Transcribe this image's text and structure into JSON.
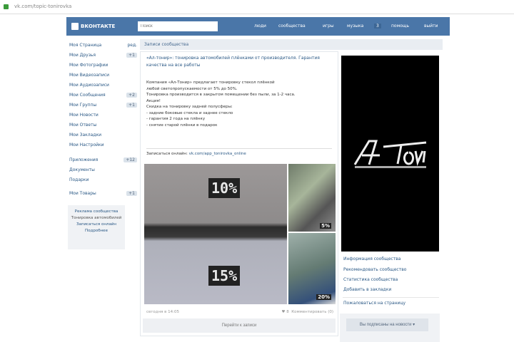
{
  "browser": {
    "url": "vk.com/topic-tonirovka"
  },
  "header": {
    "logo": "ВКОНТАКТЕ",
    "search_placeholder": "Поиск",
    "nav": [
      "люди",
      "сообщества",
      "игры",
      "музыка",
      "помощь",
      "выйти"
    ],
    "badge": "3"
  },
  "sidebar": {
    "items": [
      {
        "label": "Моя Страница",
        "count": "ред."
      },
      {
        "label": "Мои Друзья",
        "count": "+1"
      },
      {
        "label": "Мои Фотографии",
        "count": ""
      },
      {
        "label": "Мои Видеозаписи",
        "count": ""
      },
      {
        "label": "Мои Аудиозаписи",
        "count": ""
      },
      {
        "label": "Мои Сообщения",
        "count": "+2"
      },
      {
        "label": "Мои Группы",
        "count": "+1"
      },
      {
        "label": "Мои Новости",
        "count": ""
      },
      {
        "label": "Мои Ответы",
        "count": ""
      },
      {
        "label": "Мои Закладки",
        "count": ""
      },
      {
        "label": "Мои Настройки",
        "count": ""
      },
      {
        "label": "Приложения",
        "count": "+12"
      },
      {
        "label": "Документы",
        "count": ""
      },
      {
        "label": "Подарки",
        "count": ""
      },
      {
        "label": "Мои Товары",
        "count": "+1"
      }
    ],
    "promo": [
      "Реклама сообщества",
      "Тонировка автомобилей",
      "Записаться онлайн",
      "Подробнее"
    ]
  },
  "wall": {
    "header": "Записи сообщества",
    "post_title": "«Ал-тонир»: тонировка автомобилей плёнками от производителя. Гарантия качества на все работы",
    "post_lines": [
      "Компания «Ал-Тонир» предлагает тонировку стекол плёнкой",
      "любой светопропускаемости от 5% до 50%.",
      "Тонировка производится в закрытом помещении без пыли, за 1-2 часа.",
      "Акция!",
      "Скидка на тонировку задней полусферы:",
      "- задние боковые стекла и заднее стекло",
      "- гарантия 2 года на плёнку",
      "- снятие старой плёнки в подарок"
    ],
    "link_label": "Записаться онлайн:",
    "link": "vk.com/app_tonirovka_online",
    "photo_labels": [
      "10%",
      "15%",
      "5%",
      "20%"
    ],
    "date": "сегодня в 14:05",
    "likes": "8",
    "comments": "Комментировать (0)",
    "goto": "Перейти к записи"
  },
  "right": {
    "logo_text": "Al-Tonir",
    "links": [
      "Информация сообщества",
      "Рекомендовать сообщество",
      "Статистика сообщества",
      "Добавить в закладки",
      "Пожаловаться на страницу"
    ],
    "subscribe": "Вы подписаны на новости ▾"
  },
  "colors": {
    "header": "#4a76a8",
    "link": "#2a5885"
  }
}
